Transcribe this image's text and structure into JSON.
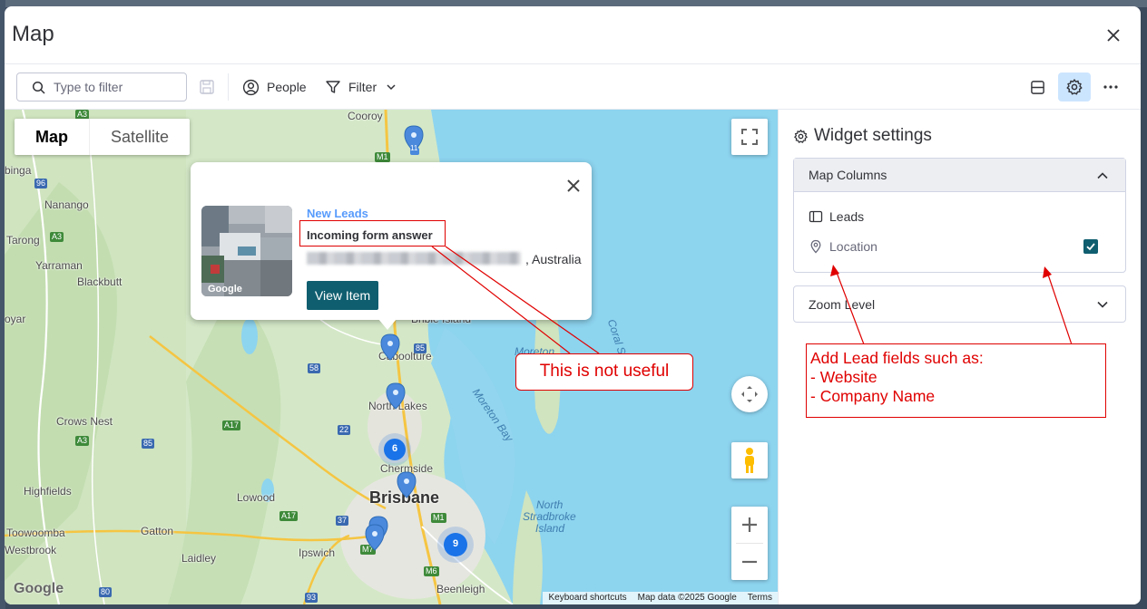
{
  "modal": {
    "title": "Map"
  },
  "toolbar": {
    "search_placeholder": "Type to filter",
    "people_label": "People",
    "filter_label": "Filter"
  },
  "map": {
    "type_map_label": "Map",
    "type_satellite_label": "Satellite",
    "attribution": {
      "shortcuts": "Keyboard shortcuts",
      "data": "Map data ©2025 Google",
      "terms": "Terms"
    },
    "google_logo": "Google",
    "labels": {
      "caboolture": "Caboolture",
      "north_lakes": "North Lakes",
      "chermside": "Chermside",
      "brisbane": "Brisbane",
      "ipswich": "Ipswich",
      "beenleigh": "Beenleigh",
      "lowood": "Lowood",
      "gatton": "Gatton",
      "toowoomba": "Toowoomba",
      "laidley": "Laidley",
      "westbrook": "Westbrook",
      "highfields": "Highfields",
      "crows_nest": "Crows Nest",
      "yarraman": "Yarraman",
      "blackbutt": "Blackbutt",
      "nanango": "Nanango",
      "tarong": "Tarong",
      "bingal": "binga",
      "oyar": "oyar",
      "cooroy": "Cooroy",
      "bribie": "Bribie Island",
      "moreton": "Moreton",
      "moreton_bay": "Moreton Bay",
      "coral_sea": "Coral Sea",
      "north_stradbroke": [
        "North",
        "Stradbroke",
        "Island"
      ]
    },
    "roads": [
      "A3",
      "96",
      "A3",
      "A17",
      "85",
      "A3",
      "M1",
      "58",
      "22",
      "85",
      "A17",
      "37",
      "M7",
      "M1",
      "M6",
      "93",
      "80",
      "A3"
    ],
    "clusters": [
      "6",
      "9"
    ],
    "pins": [
      "11"
    ]
  },
  "popup": {
    "image_watermark": "Google",
    "group_name": "New Leads",
    "item_name": "Incoming form answer",
    "address_suffix": ", Australia",
    "view_button": "View Item"
  },
  "panel": {
    "title": "Widget settings",
    "map_columns_label": "Map Columns",
    "board_name": "Leads",
    "location_column": "Location",
    "location_checked": true,
    "zoom_level_label": "Zoom Level"
  },
  "annotations": {
    "bubble": "This is not useful",
    "note_lines": [
      "Add Lead fields such as:",
      "- Website",
      "- Company Name"
    ]
  },
  "colors": {
    "accent": "#0f5e6f",
    "primary_blue": "#579bfc",
    "annotation_red": "#e00000",
    "water": "#8dd4ef",
    "land": "#d4e8c7"
  }
}
